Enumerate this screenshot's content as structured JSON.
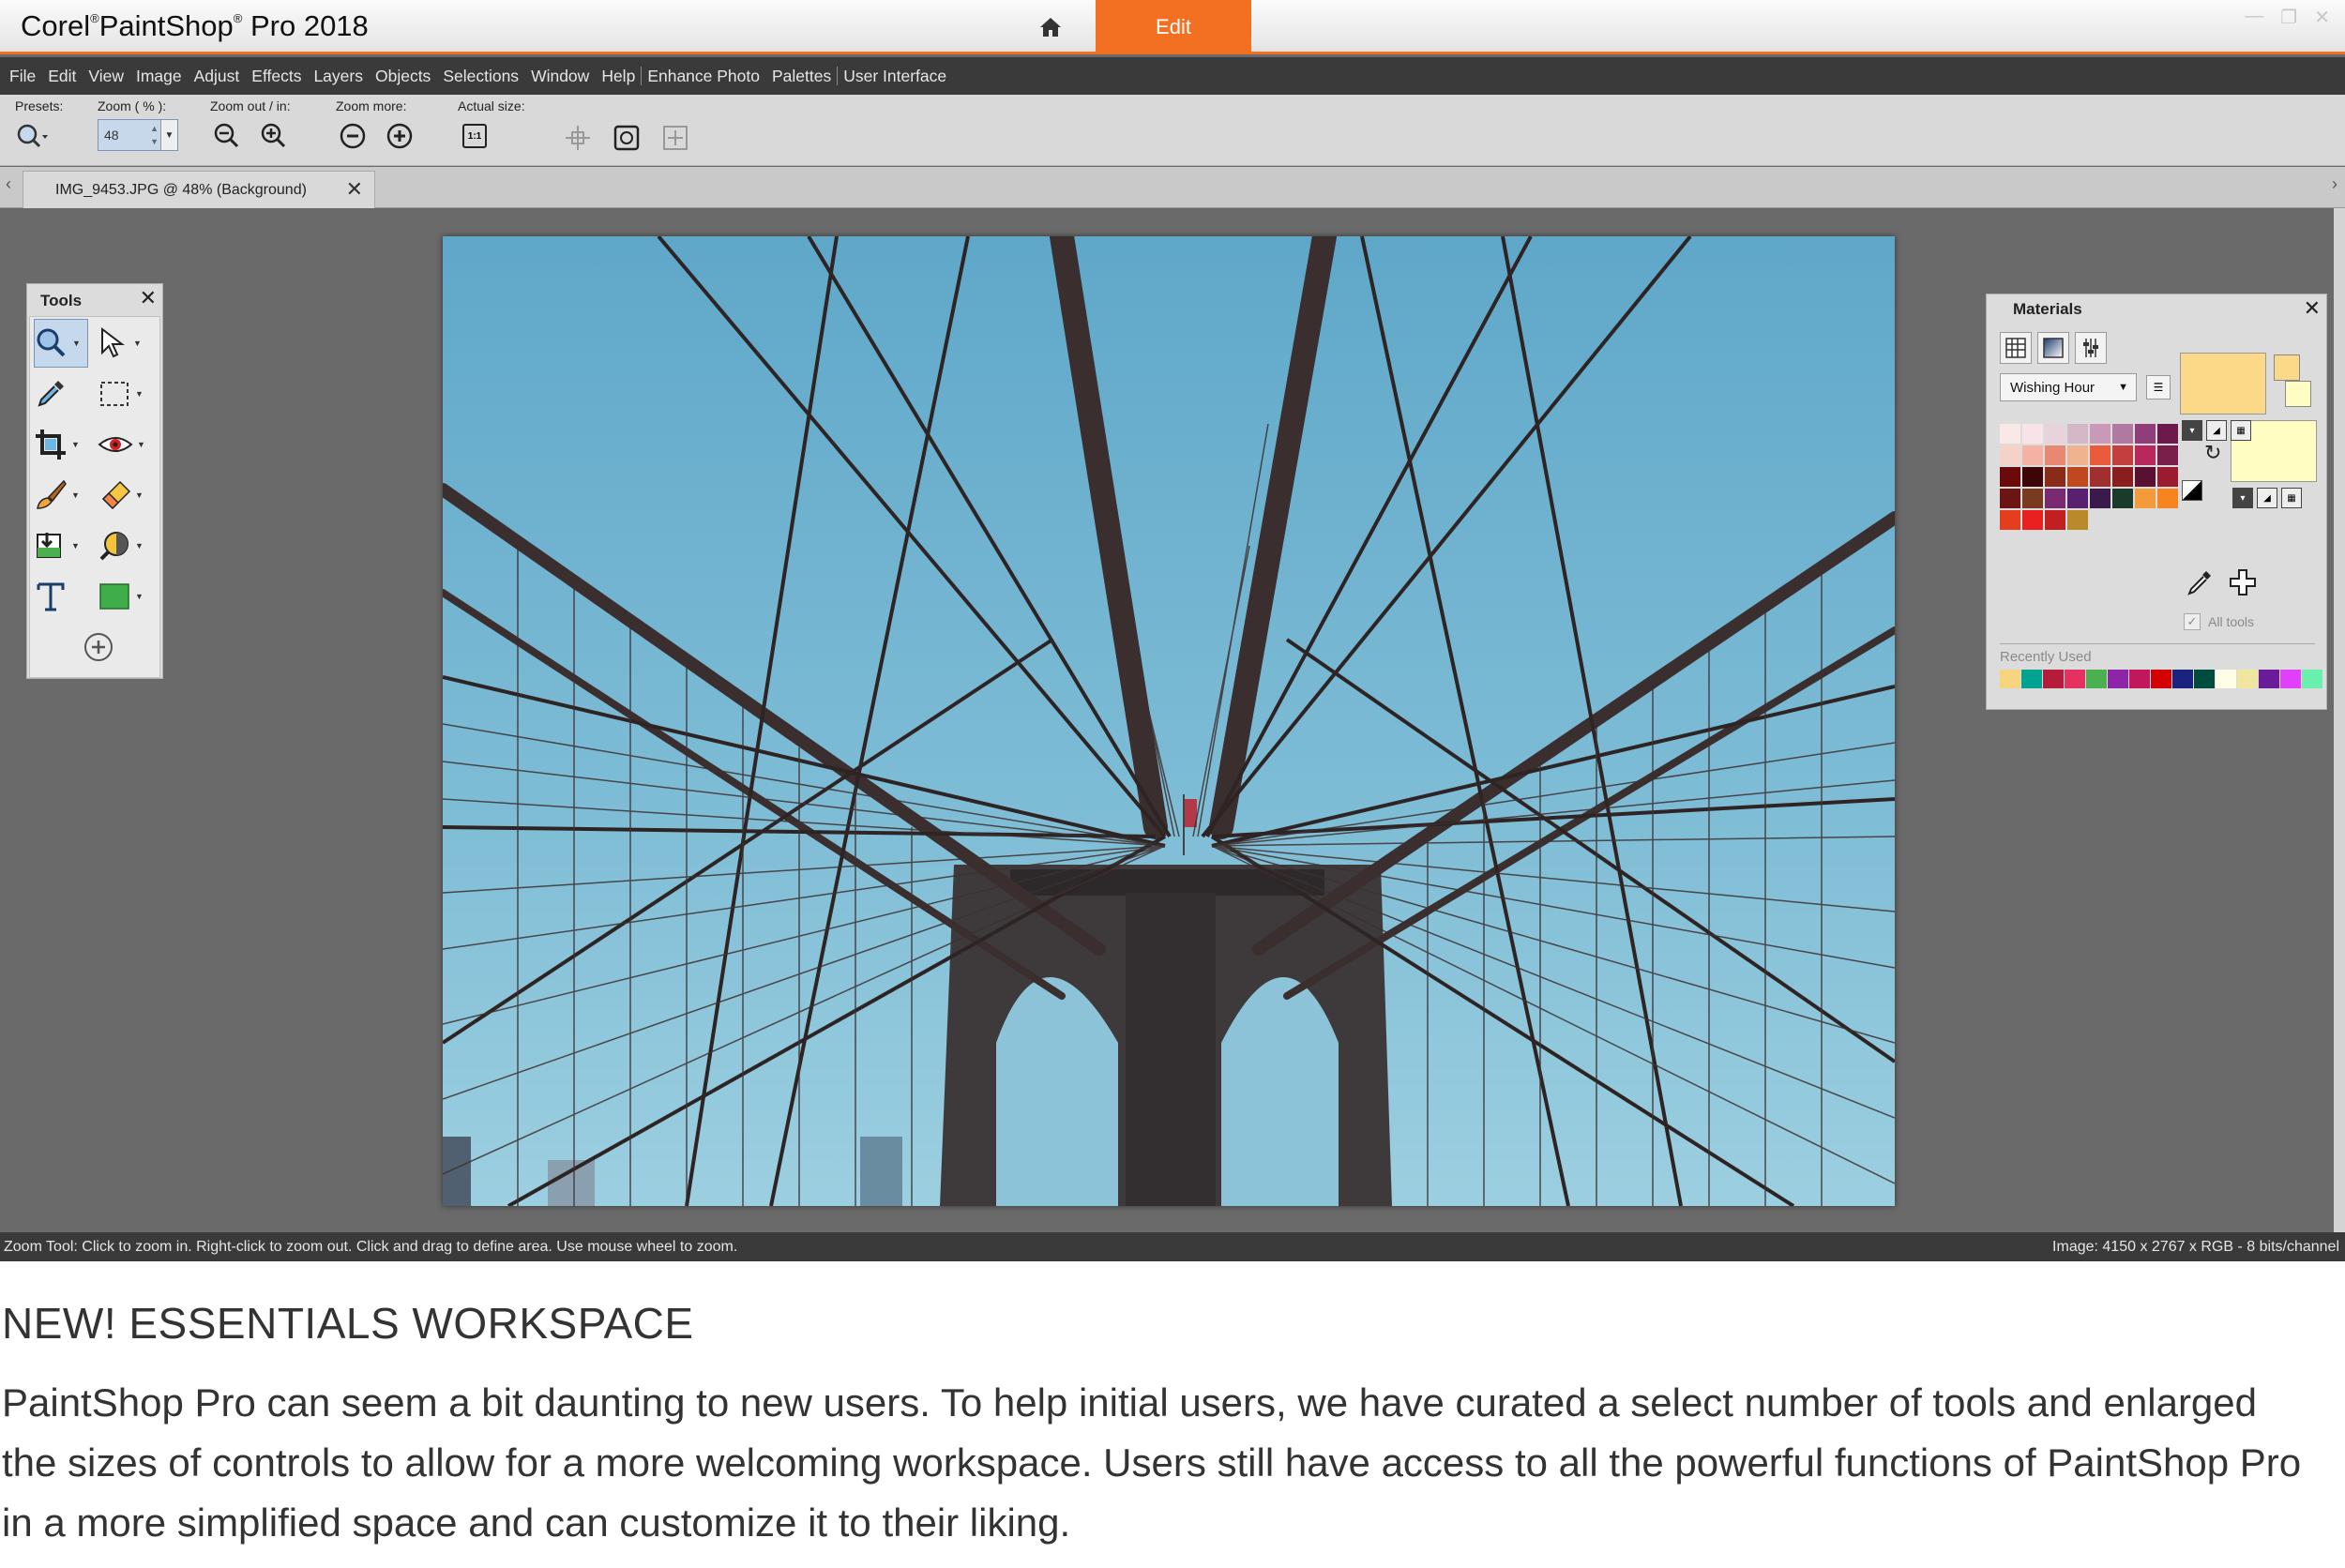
{
  "app": {
    "title_brand": "Corel",
    "title_product": "PaintShop",
    "title_rest": "Pro 2018",
    "edit_tab": "Edit"
  },
  "menu": [
    "File",
    "Edit",
    "View",
    "Image",
    "Adjust",
    "Effects",
    "Layers",
    "Objects",
    "Selections",
    "Window",
    "Help",
    "Enhance Photo",
    "Palettes",
    "User Interface"
  ],
  "options": {
    "presets_label": "Presets:",
    "zoom_label": "Zoom ( % ):",
    "zoom_value": "48",
    "zoom_out_in_label": "Zoom out / in:",
    "zoom_more_label": "Zoom more:",
    "actual_size_label": "Actual size:",
    "actual_size_btn": "1:1"
  },
  "document_tab": {
    "label": "IMG_9453.JPG @  48% (Background)"
  },
  "tools_palette": {
    "title": "Tools",
    "tools": [
      "zoom-icon",
      "pick-icon",
      "dropper-icon",
      "selection-icon",
      "crop-icon",
      "red-eye-icon",
      "paint-brush-icon",
      "eraser-icon",
      "flood-fill-icon",
      "dodge-icon",
      "text-icon",
      "rectangle-icon"
    ]
  },
  "materials": {
    "title": "Materials",
    "swatch_set": "Wishing Hour",
    "all_tools_label": "All tools",
    "recently_used_label": "Recently Used",
    "foreground_color": "#fcd889",
    "background_color": "#fffdc2",
    "swatches": [
      "#f9e8e5",
      "#f8e4e8",
      "#e8d3dc",
      "#d5b8c8",
      "#c99ab8",
      "#b07aa0",
      "#8e3e78",
      "#6b1a4b",
      "#f4d2c8",
      "#f5b2a4",
      "#e98872",
      "#f0b390",
      "#e95b3a",
      "#c33f3d",
      "#b8285a",
      "#7a1e4a",
      "#6a0a0a",
      "#3d0505",
      "#8a2a18",
      "#c0481e",
      "#a03030",
      "#8a1e1e",
      "#5a1030",
      "#9b1b30",
      "#6a1512",
      "#7a3a20",
      "#7a2a70",
      "#5a2070",
      "#3a1a4a",
      "#1a3a2a",
      "#f39b3b",
      "#f7841e",
      "#e53e1e",
      "#e82020",
      "#c22020",
      "#b88a2a"
    ],
    "recent": [
      "#f6d57e",
      "#00a292",
      "#b41c3a",
      "#e63060",
      "#4caf50",
      "#8e24aa",
      "#c2185b",
      "#d50000",
      "#1a237e",
      "#004d40",
      "#fffde7",
      "#f0e6a0",
      "#6a1b9a",
      "#e040fb",
      "#69f0ae"
    ]
  },
  "status": {
    "left": "Zoom Tool: Click to zoom in. Right-click to zoom out. Click and drag to define area. Use mouse wheel to zoom.",
    "right": "Image:  4150 x 2767 x RGB - 8 bits/channel"
  },
  "caption": {
    "title": "NEW! ESSENTIALS WORKSPACE",
    "body": "PaintShop Pro can seem a bit daunting to new users. To help initial users, we have curated a select number of tools and enlarged the sizes of controls to allow for a more welcoming workspace. Users still have access to all the powerful functions of PaintShop Pro in a more simplified space and can customize it to their liking."
  }
}
